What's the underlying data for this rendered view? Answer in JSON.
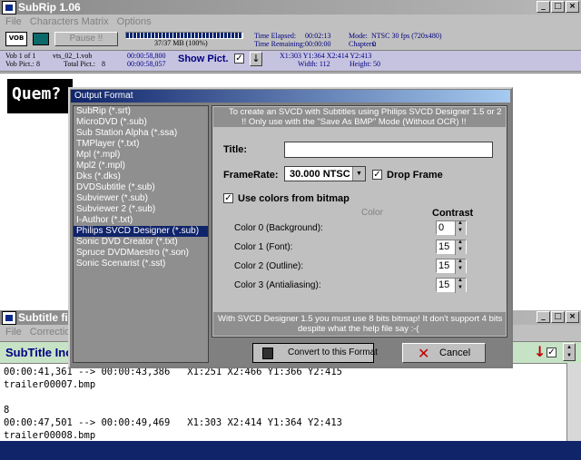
{
  "main_window": {
    "title": "SubRip 1.06",
    "menus": [
      "File",
      "Characters Matrix",
      "Options"
    ],
    "pause_label": "Pause !!",
    "progress_label": "37/37 MB (100%)",
    "progress_fraction": 1.0,
    "time_elapsed_label": "Time Elapsed:",
    "time_elapsed": "00:02:13",
    "time_remaining_label": "Time Remaining:",
    "time_remaining": "00:00:00",
    "mode_label": "Mode:",
    "mode": "NTSC 30 fps (720x480)",
    "chapters_label": "Chapters:",
    "chapters": "0",
    "vob_of": "Vob 1 of 1",
    "vob_file": "vts_02_1.vob",
    "vob_pict_label": "Vob Pict.:",
    "vob_pict": "8",
    "total_pict_label": "Total Pict.:",
    "total_pict": "8",
    "time_a": "00:00:58,800",
    "time_b": "00:00:58,057",
    "show_pict_label": "Show Pict.",
    "coords": "X1:303  Y1:364  X2:414  Y2:413",
    "width": "Width: 112",
    "height": "Height: 50",
    "preview_text": "Quem? S?"
  },
  "subtitle_window": {
    "title": "Subtitle file",
    "menus": [
      "File",
      "Correction"
    ],
    "heading": "SubTitle Inc",
    "lines": [
      "00:00:41,361 --> 00:00:43,386   X1:251 X2:466 Y1:366 Y2:415",
      "trailer00007.bmp",
      "",
      "8",
      "00:00:47,501 --> 00:00:49,469   X1:303 X2:414 Y1:364 Y2:413",
      "trailer00008.bmp"
    ]
  },
  "dialog": {
    "title": "Output Format",
    "formats": [
      "SubRip (*.srt)",
      "MicroDVD (*.sub)",
      "Sub Station Alpha (*.ssa)",
      "TMPlayer (*.txt)",
      "Mpl (*.mpl)",
      "Mpl2 (*.mpl)",
      "Dks (*.dks)",
      "DVDSubtitle (*.sub)",
      "Subviewer (*.sub)",
      "Subviewer 2 (*.sub)",
      "I-Author (*.txt)",
      "Philips SVCD Designer (*.sub)",
      "Sonic DVD Creator (*.txt)",
      "Spruce DVDMaestro (*.son)",
      "Sonic Scenarist (*.sst)"
    ],
    "selected_index": 11,
    "info_line1": "To create an SVCD with Subtitles using Philips SVCD Designer 1.5 or 2",
    "info_line2": "!! Only use with the \"Save As BMP\" Mode (Without OCR) !!",
    "title_label": "Title:",
    "title_value": "",
    "framerate_label": "FrameRate:",
    "framerate_value": "30.000 NTSC",
    "drop_frame_label": "Drop Frame",
    "drop_frame_checked": true,
    "use_colors_label": "Use colors from bitmap",
    "use_colors_checked": true,
    "color_header": "Color",
    "contrast_header": "Contrast",
    "colors": [
      {
        "label": "Color 0 (Background):",
        "contrast": "0"
      },
      {
        "label": "Color 1 (Font):",
        "contrast": "15"
      },
      {
        "label": "Color 2 (Outline):",
        "contrast": "15"
      },
      {
        "label": "Color 3 (Antialiasing):",
        "contrast": "15"
      }
    ],
    "footer_line1": "With SVCD Designer 1.5 you must use 8 bits bitmap! It don't support 4 bits",
    "footer_line2": "despite what the help file say :-(",
    "convert_label": "Convert to this Format",
    "cancel_label": "Cancel",
    "accent": "#10246a"
  }
}
